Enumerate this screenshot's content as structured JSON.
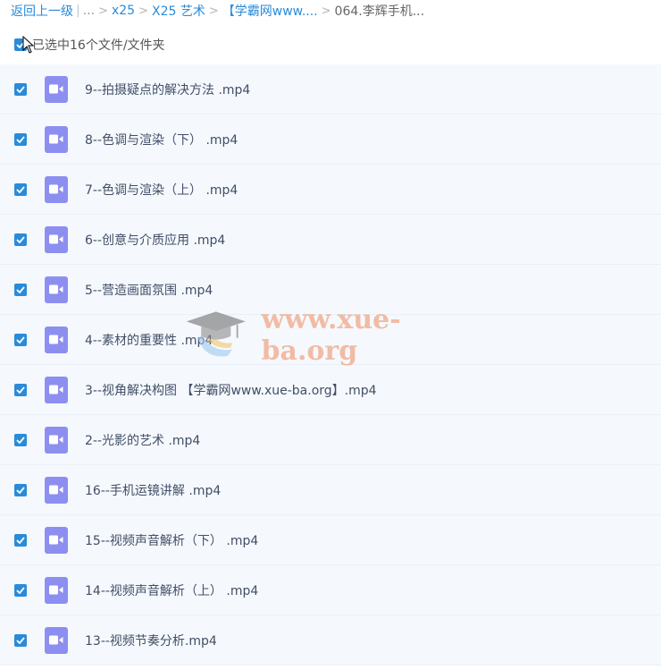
{
  "breadcrumb": {
    "back": "返回上一级",
    "ellipsis": "...",
    "items": [
      "x25",
      "X25 艺术",
      "【学霸网www....",
      "064.李辉手机..."
    ]
  },
  "selection": {
    "label": "已选中16个文件/文件夹",
    "checked": true
  },
  "files": [
    {
      "name": "9--拍摄疑点的解决方法 .mp4",
      "checked": true
    },
    {
      "name": "8--色调与渲染（下） .mp4",
      "checked": true
    },
    {
      "name": "7--色调与渲染（上） .mp4",
      "checked": true
    },
    {
      "name": "6--创意与介质应用 .mp4",
      "checked": true
    },
    {
      "name": "5--营造画面氛围 .mp4",
      "checked": true
    },
    {
      "name": "4--素材的重要性 .mp4",
      "checked": true
    },
    {
      "name": "3--视角解决构图 【学霸网www.xue-ba.org】.mp4",
      "checked": true
    },
    {
      "name": "2--光影的艺术 .mp4",
      "checked": true
    },
    {
      "name": "16--手机运镜讲解 .mp4",
      "checked": true
    },
    {
      "name": "15--视频声音解析（下） .mp4",
      "checked": true
    },
    {
      "name": "14--视频声音解析（上） .mp4",
      "checked": true
    },
    {
      "name": "13--视频节奏分析.mp4",
      "checked": true
    }
  ],
  "watermark": {
    "text": "www.xue-ba.org"
  },
  "icons": {
    "file_type": "video-file-icon",
    "checkbox": "checkmark-icon",
    "cursor": "mouse-pointer-icon",
    "watermark_logo": "graduation-cap-icon"
  },
  "colors": {
    "link": "#2a8bd9",
    "checkbox": "#2a8bd9",
    "video_icon": "#8c8ff0",
    "row_background": "#f5f9fd",
    "watermark": "#f08a5d"
  }
}
